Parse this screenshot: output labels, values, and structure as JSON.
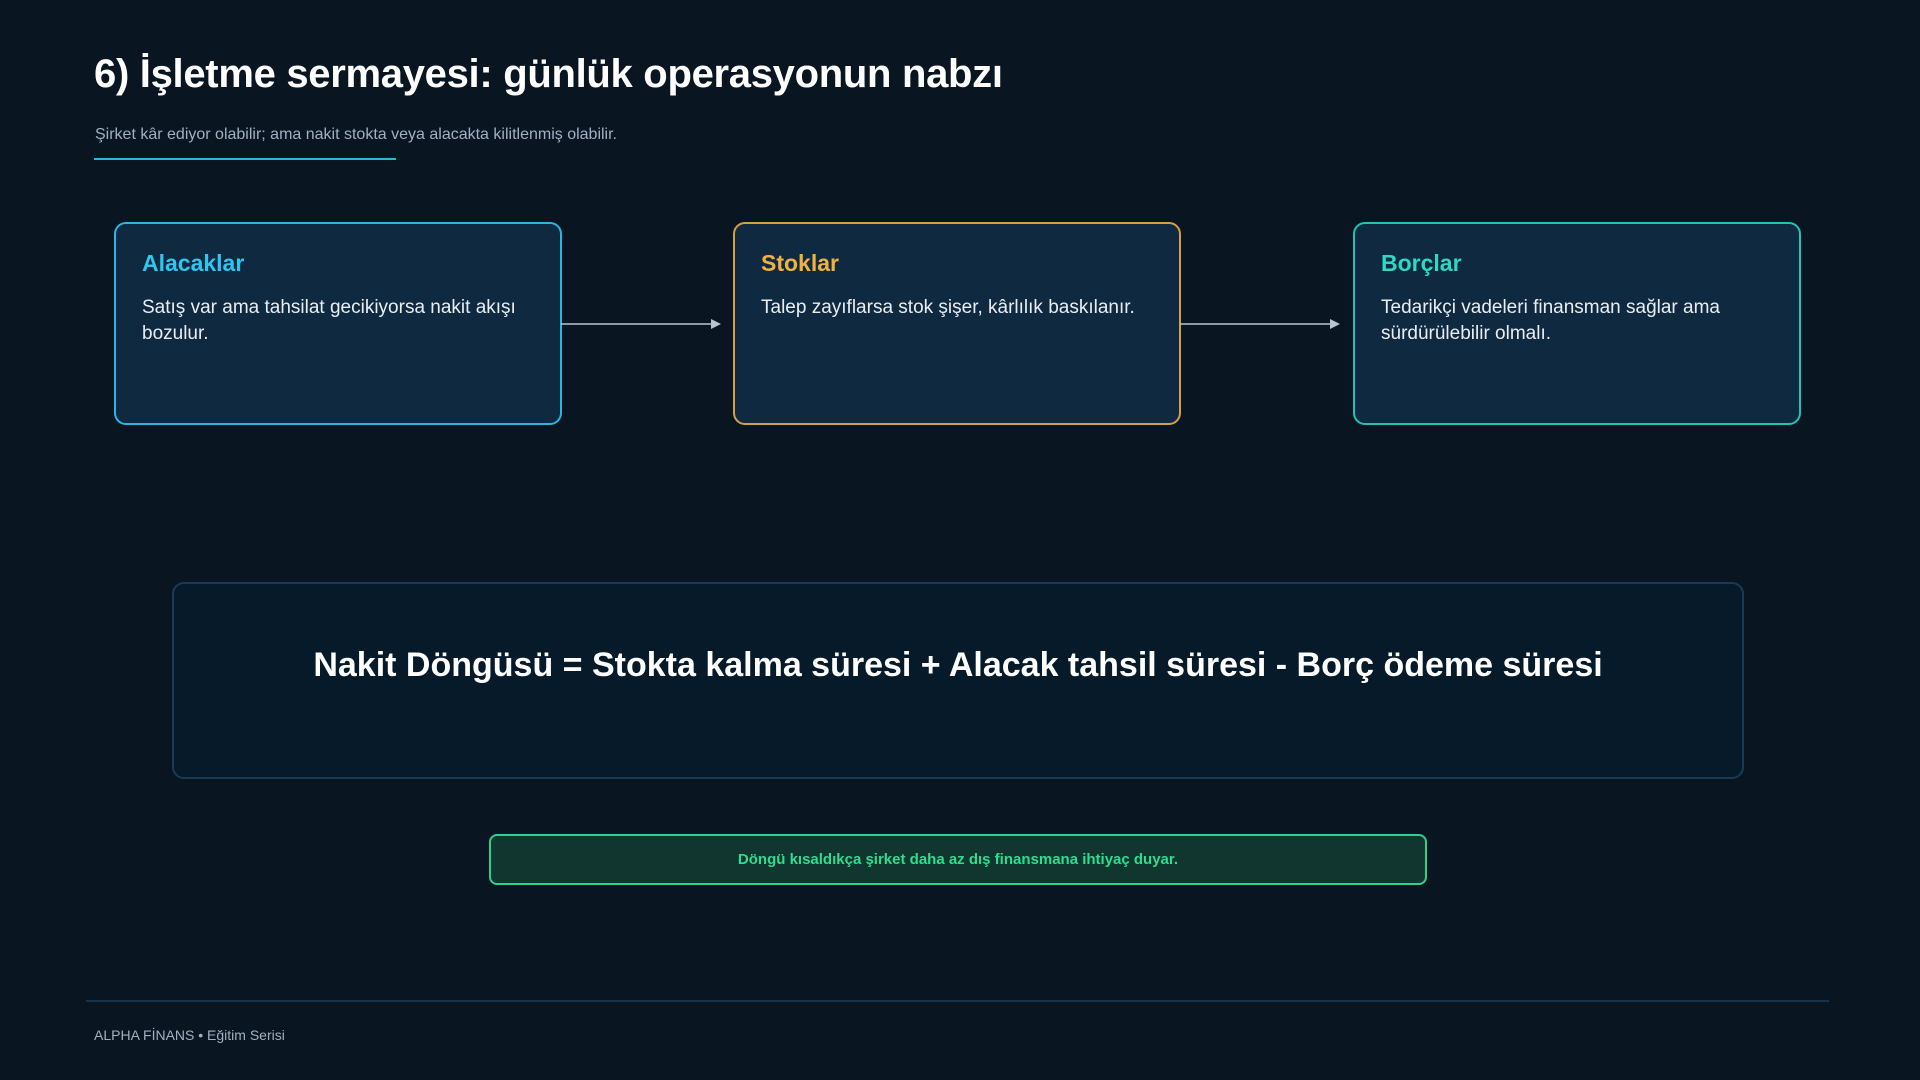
{
  "header": {
    "title": "6) İşletme sermayesi: günlük operasyonun nabzı",
    "subtitle": "Şirket kâr ediyor olabilir; ama nakit stokta veya alacakta kilitlenmiş olabilir."
  },
  "cards": [
    {
      "title": "Alacaklar",
      "body": "Satış var ama tahsilat gecikiyorsa nakit akışı bozulur.",
      "color": "#29b6e0"
    },
    {
      "title": "Stoklar",
      "body": "Talep zayıflarsa stok şişer, kârlılık baskılanır.",
      "color": "#d4a041"
    },
    {
      "title": "Borçlar",
      "body": "Tedarikçi vadeleri finansman sağlar ama sürdürülebilir olmalı.",
      "color": "#1fc4b2"
    }
  ],
  "formula": "Nakit Döngüsü = Stokta kalma süresi + Alacak tahsil süresi - Borç ödeme süresi",
  "note": "Döngü kısaldıkça şirket daha az dış finansmana ihtiyaç duyar.",
  "footer": {
    "text": "ALPHA FİNANS • Eğitim Serisi"
  },
  "colors": {
    "background": "#0a1522",
    "accent": "#29b6e0",
    "note_green": "#2fcf8c"
  }
}
